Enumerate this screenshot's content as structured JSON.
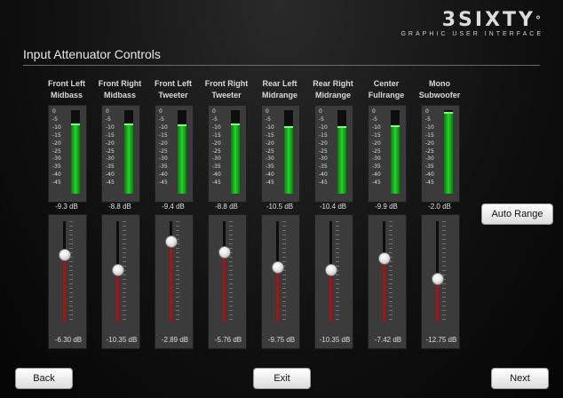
{
  "brand": {
    "logo": "3SIXTY",
    "degree": "°",
    "subtitle": "GRAPHIC USER INTERFACE"
  },
  "page_title": "Input Attenuator Controls",
  "scale": [
    "0",
    "-5",
    "-10",
    "-15",
    "-20",
    "-25",
    "-30",
    "-35",
    "-40",
    "-45"
  ],
  "channels": [
    {
      "line1": "Front Left",
      "line2": "Midbass",
      "meter": "-9.3 dB",
      "meter_db": -9.3,
      "fader": "-6.30 dB",
      "fader_db": -6.3
    },
    {
      "line1": "Front Right",
      "line2": "Midbass",
      "meter": "-8.8 dB",
      "meter_db": -8.8,
      "fader": "-10.35 dB",
      "fader_db": -10.35
    },
    {
      "line1": "Front Left",
      "line2": "Tweeter",
      "meter": "-9.4 dB",
      "meter_db": -9.4,
      "fader": "-2.89 dB",
      "fader_db": -2.89
    },
    {
      "line1": "Front Right",
      "line2": "Tweeter",
      "meter": "-8.8 dB",
      "meter_db": -8.8,
      "fader": "-5.76 dB",
      "fader_db": -5.76
    },
    {
      "line1": "Rear Left",
      "line2": "Midrange",
      "meter": "-10.5 dB",
      "meter_db": -10.5,
      "fader": "-9.75 dB",
      "fader_db": -9.75
    },
    {
      "line1": "Rear Right",
      "line2": "Midrange",
      "meter": "-10.4 dB",
      "meter_db": -10.4,
      "fader": "-10.35 dB",
      "fader_db": -10.35
    },
    {
      "line1": "Center",
      "line2": "Fullrange",
      "meter": "-9.9 dB",
      "meter_db": -9.9,
      "fader": "-7.42 dB",
      "fader_db": -7.42
    },
    {
      "line1": "Mono",
      "line2": "Subwoofer",
      "meter": "-2.0 dB",
      "meter_db": -2.0,
      "fader": "-12.75 dB",
      "fader_db": -12.75
    }
  ],
  "buttons": {
    "auto_range": "Auto Range",
    "back": "Back",
    "exit": "Exit",
    "next": "Next"
  },
  "colors": {
    "meter_green": "#22d42a",
    "fader_red": "#b01010"
  }
}
